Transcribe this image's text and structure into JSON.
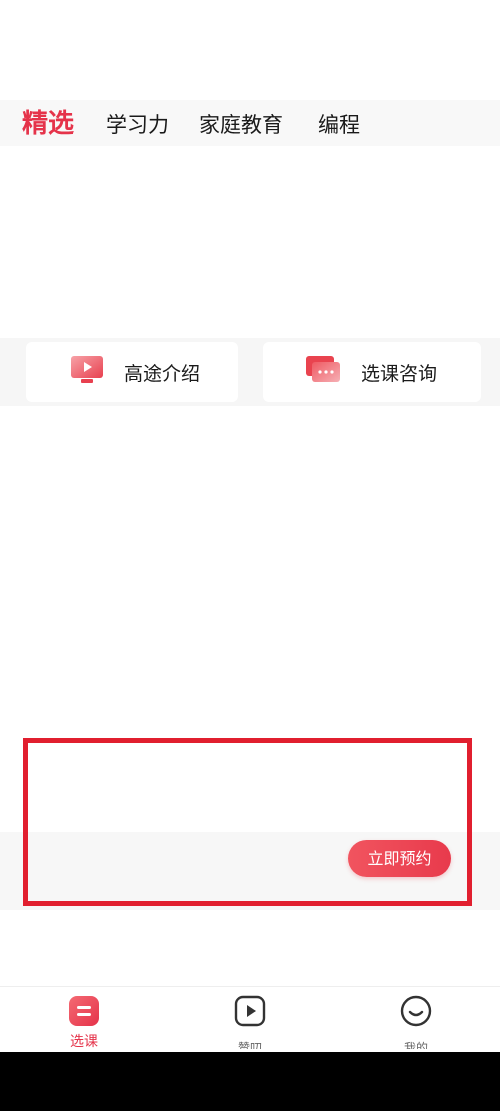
{
  "tabs": [
    {
      "label": "精选",
      "active": true
    },
    {
      "label": "学习力",
      "active": false
    },
    {
      "label": "家庭教育",
      "active": false
    },
    {
      "label": "编程",
      "active": false
    }
  ],
  "quick_links": [
    {
      "label": "高途介绍",
      "icon": "monitor-play-icon"
    },
    {
      "label": "选课咨询",
      "icon": "chat-bubble-icon"
    }
  ],
  "banner": {
    "button_label": "立即预约",
    "highlight_color": "#e11f2f"
  },
  "bottom_nav": [
    {
      "label": "选课",
      "icon": "course-icon",
      "active": true
    },
    {
      "label": "赞叨",
      "icon": "play-icon",
      "active": false
    },
    {
      "label": "我的",
      "icon": "smile-face-icon",
      "active": false
    }
  ],
  "colors": {
    "accent": "#e5334a",
    "button_start": "#f1545f",
    "button_end": "#e83a4c"
  }
}
